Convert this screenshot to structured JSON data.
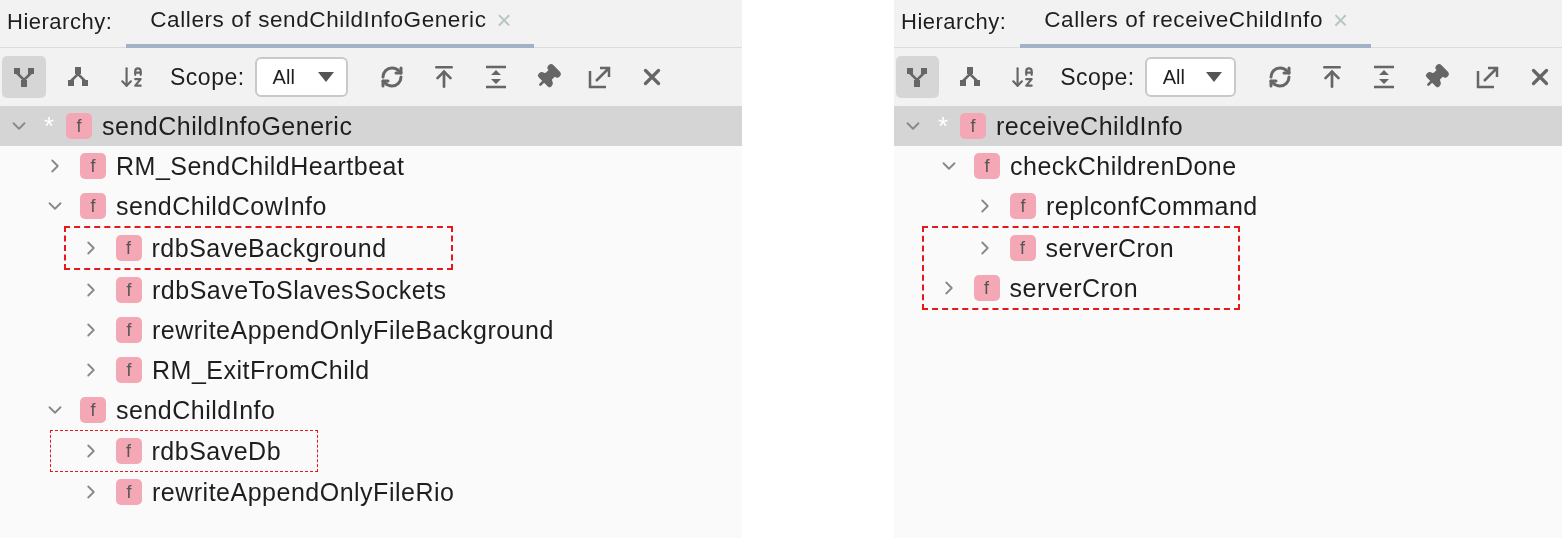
{
  "panels": [
    {
      "label": "Hierarchy:",
      "tab": {
        "title": "Callers of sendChildInfoGeneric",
        "close": "×",
        "selected": true
      },
      "toolbar": {
        "tools": [
          {
            "kind": "callers",
            "selected": true
          },
          {
            "kind": "callees",
            "selected": false
          },
          {
            "kind": "sort",
            "selected": false
          }
        ],
        "scope_label": "Scope:",
        "scope_value": "All",
        "actions": [
          {
            "kind": "refresh"
          },
          {
            "kind": "export"
          },
          {
            "kind": "expand"
          },
          {
            "kind": "pin"
          },
          {
            "kind": "open"
          },
          {
            "kind": "close"
          }
        ]
      },
      "tree": {
        "root": {
          "label": "sendChildInfoGeneric",
          "icon": "f",
          "marker": "*",
          "expanded": true,
          "selected": true,
          "children": [
            {
              "label": "RM_SendChildHeartbeat",
              "icon": "f",
              "expanded": false,
              "highlighted": false
            },
            {
              "label": "sendChildCowInfo",
              "icon": "f",
              "expanded": true,
              "highlighted": false,
              "children": [
                {
                  "label": "rdbSaveBackground",
                  "icon": "f",
                  "expanded": false,
                  "highlighted": true,
                  "thin": false
                },
                {
                  "label": "rdbSaveToSlavesSockets",
                  "icon": "f",
                  "expanded": false,
                  "highlighted": false
                },
                {
                  "label": "rewriteAppendOnlyFileBackground",
                  "icon": "f",
                  "expanded": false,
                  "highlighted": false
                },
                {
                  "label": "RM_ExitFromChild",
                  "icon": "f",
                  "expanded": false,
                  "highlighted": false
                }
              ]
            },
            {
              "label": "sendChildInfo",
              "icon": "f",
              "expanded": true,
              "highlighted": false,
              "children": [
                {
                  "label": "rdbSaveDb",
                  "icon": "f",
                  "expanded": false,
                  "highlighted": true,
                  "thin": true
                },
                {
                  "label": "rewriteAppendOnlyFileRio",
                  "icon": "f",
                  "expanded": false,
                  "highlighted": false
                }
              ]
            }
          ]
        }
      }
    },
    {
      "label": "Hierarchy:",
      "tab": {
        "title": "Callers of receiveChildInfo",
        "close": "×",
        "selected": true
      },
      "toolbar": {
        "tools": [
          {
            "kind": "callers",
            "selected": true
          },
          {
            "kind": "callees",
            "selected": false
          },
          {
            "kind": "sort",
            "selected": false
          }
        ],
        "scope_label": "Scope:",
        "scope_value": "All",
        "actions": [
          {
            "kind": "refresh"
          },
          {
            "kind": "export"
          },
          {
            "kind": "expand"
          },
          {
            "kind": "pin"
          },
          {
            "kind": "open"
          },
          {
            "kind": "close"
          }
        ]
      },
      "tree": {
        "root": {
          "label": "receiveChildInfo",
          "icon": "f",
          "marker": "*",
          "expanded": true,
          "selected": true,
          "children": [
            {
              "label": "checkChildrenDone",
              "icon": "f",
              "expanded": true,
              "highlighted": false,
              "children": [
                {
                  "label": "replconfCommand",
                  "icon": "f",
                  "expanded": false,
                  "highlighted": false
                },
                {
                  "label": "serverCron",
                  "icon": "f",
                  "expanded": false,
                  "highlighted": true,
                  "thin": false
                }
              ]
            },
            {
              "label": "serverCron",
              "icon": "f",
              "expanded": false,
              "highlighted": true,
              "thin": false
            }
          ]
        }
      }
    }
  ]
}
